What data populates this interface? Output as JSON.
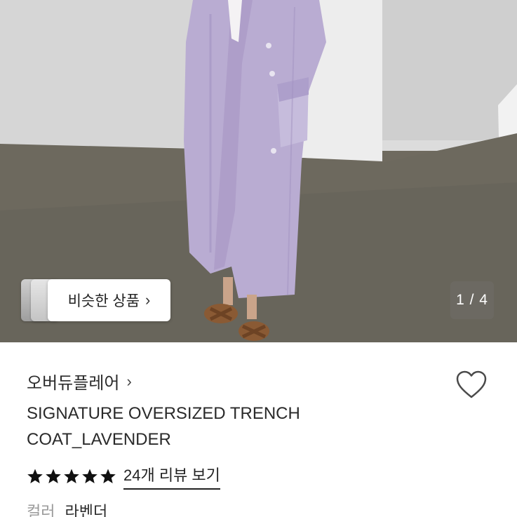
{
  "gallery": {
    "similar_button_label": "비슷한 상품",
    "page_indicator": "1 / 4",
    "current_index": 1,
    "total": 4
  },
  "product": {
    "brand": "오버듀플레어",
    "title": "SIGNATURE OVERSIZED TRENCH COAT_LAVENDER",
    "rating_stars": 5,
    "review_link": "24개 리뷰 보기",
    "option_label": "컬러",
    "option_value": "라벤더"
  },
  "colors": {
    "coat": "#b9acd2",
    "star": "#111111"
  },
  "icons": {
    "favorite": "heart-outline-icon",
    "next": "chevron-right-icon",
    "rating": "star-icon"
  }
}
